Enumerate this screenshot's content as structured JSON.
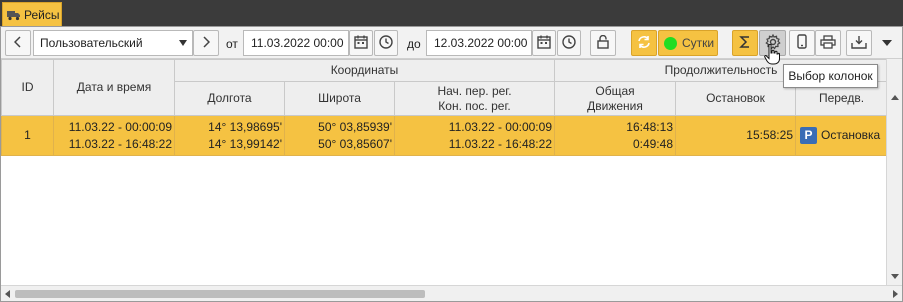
{
  "tab": {
    "label": "Рейсы",
    "icon": "truck-icon"
  },
  "toolbar": {
    "period_select": "Пользовательский",
    "from_label": "от",
    "from_value": "11.03.2022 00:00",
    "to_label": "до",
    "to_value": "12.03.2022 00:00",
    "day_label": "Сутки",
    "day_status_color": "#22dd22"
  },
  "tooltip": "Выбор колонок",
  "table": {
    "headers": {
      "id": "ID",
      "datetime": "Дата и время",
      "coords_group": "Координаты",
      "longitude": "Долгота",
      "latitude": "Широта",
      "reg_line1": "Нач. пер. рег.",
      "reg_line2": "Кон. пос. рег.",
      "duration_group": "Продолжительность",
      "total_line1": "Общая",
      "total_line2": "Движения",
      "stops": "Остановок",
      "transfer": "Передв."
    },
    "row": {
      "id": "1",
      "datetime_start": "11.03.22 - 00:00:09",
      "datetime_end": "11.03.22 - 16:48:22",
      "lon_start": "14° 13,98695'",
      "lon_end": "14° 13,99142'",
      "lat_start": "50° 03,85939'",
      "lat_end": "50° 03,85607'",
      "reg_start": "11.03.22 - 00:00:09",
      "reg_end": "11.03.22 - 16:48:22",
      "total": "16:48:13",
      "moving": "0:49:48",
      "stops": "15:58:25",
      "status_badge": "P",
      "status": "Остановка"
    },
    "highlight_color": "#f5c242"
  }
}
